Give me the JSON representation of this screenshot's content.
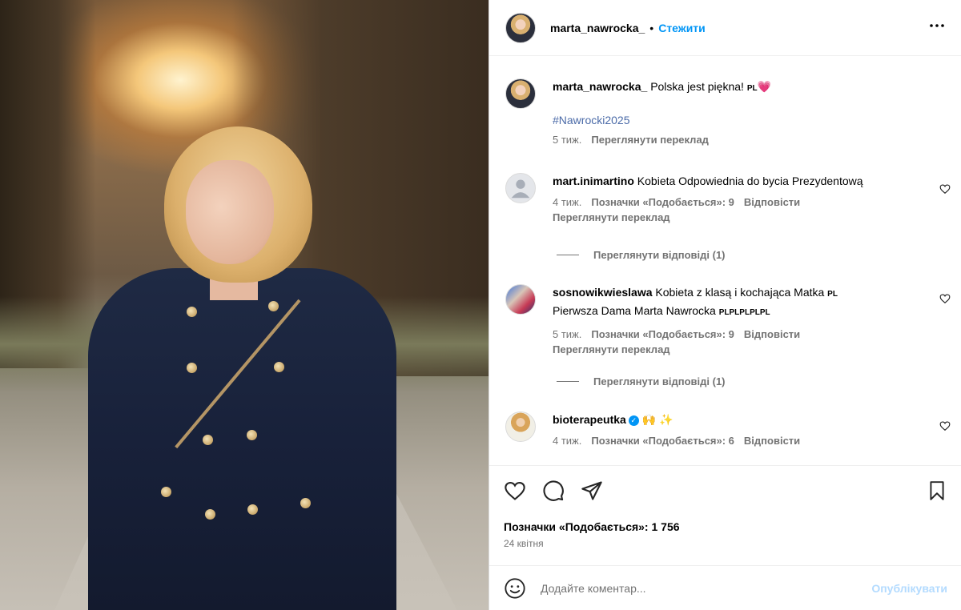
{
  "post": {
    "author": "marta_nawrocka_",
    "follow_label": "Стежити",
    "separator": "•",
    "more_label": "•••",
    "photo_alt": "Photo"
  },
  "caption": {
    "username": "marta_nawrocka_",
    "text": "Polska jest piękna!",
    "flag": "PL",
    "emoji": "💗",
    "hashtag": "#Nawrocki2025",
    "time": "5 тиж.",
    "translate": "Переглянути переклад"
  },
  "comments": [
    {
      "username": "mart.inimartino",
      "text": "Kobieta Odpowiednia do bycia Prezydentową",
      "time": "4 тиж.",
      "likes": "Позначки «Подобається»: 9",
      "reply": "Відповісти",
      "translate": "Переглянути переклад",
      "view_replies": "Переглянути відповіді (1)"
    },
    {
      "username": "sosnowikwieslawa",
      "text": "Kobieta z klasą i kochająca Matka",
      "flag": "PL",
      "text2": "Pierwsza Dama Marta Nawrocka",
      "flags2": "PLPLPLPLPL",
      "time": "5 тиж.",
      "likes": "Позначки «Подобається»: 9",
      "reply": "Відповісти",
      "translate": "Переглянути переклад",
      "view_replies": "Переглянути відповіді (1)"
    },
    {
      "username": "bioterapeutka",
      "verified": "✓",
      "emoji": "🙌 ✨",
      "time": "4 тиж.",
      "likes": "Позначки «Подобається»: 6",
      "reply": "Відповісти"
    }
  ],
  "actions": {
    "likes_total": "Позначки «Подобається»: 1 756",
    "date": "24 квітня"
  },
  "composer": {
    "placeholder": "Додайте коментар...",
    "publish": "Опублікувати"
  }
}
